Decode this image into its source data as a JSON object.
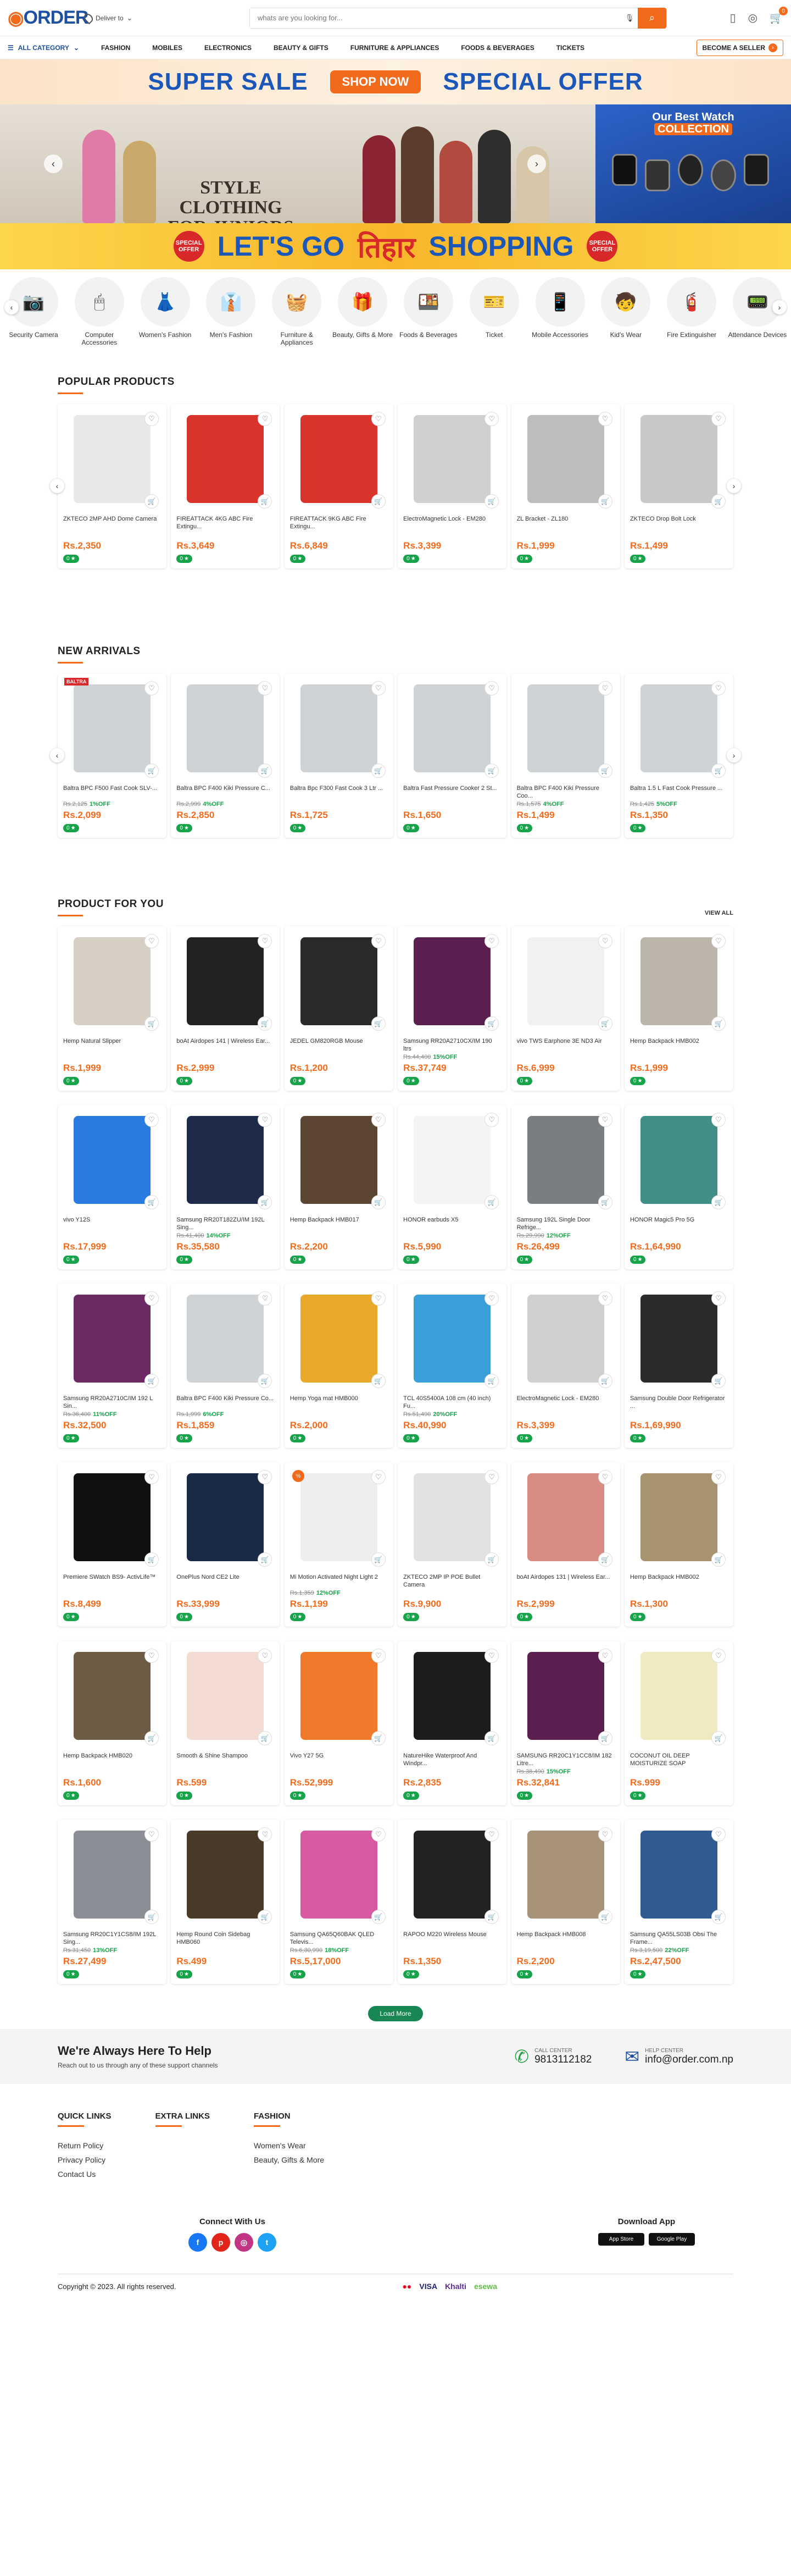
{
  "header": {
    "logo": "ORDER",
    "deliver": "Deliver to",
    "search_placeholder": "whats are you looking for...",
    "cart_count": "0"
  },
  "nav": {
    "all_category": "ALL CATEGORY",
    "items": [
      "FASHION",
      "MOBILES",
      "ELECTRONICS",
      "BEAUTY & GIFTS",
      "FURNITURE & APPLIANCES",
      "FOODS & BEVERAGES",
      "TICKETS"
    ],
    "seller": "BECOME A SELLER"
  },
  "banners": {
    "sale_left": "SUPER SALE",
    "sale_btn": "SHOP NOW",
    "sale_right": "SPECIAL OFFER",
    "hero_text": "STYLE CLOTHING FOR JUNIORS",
    "watch_title_1": "Our Best Watch",
    "watch_title_2": "COLLECTION",
    "tihar_left": "LET'S GO",
    "tihar_mid": "तिहार",
    "tihar_right": "SHOPPING",
    "tihar_tag": "SPECIAL OFFER"
  },
  "categories": [
    {
      "name": "Security Camera",
      "icon": "📷"
    },
    {
      "name": "Computer Accessories",
      "icon": "🖱"
    },
    {
      "name": "Women's Fashion",
      "icon": "👗"
    },
    {
      "name": "Men's Fashion",
      "icon": "👔"
    },
    {
      "name": "Furniture & Appliances",
      "icon": "🧺"
    },
    {
      "name": "Beauty, Gifts & More",
      "icon": "🎁"
    },
    {
      "name": "Foods & Beverages",
      "icon": "🍱"
    },
    {
      "name": "Ticket",
      "icon": "🎫"
    },
    {
      "name": "Mobile Accessories",
      "icon": "📱"
    },
    {
      "name": "Kid's Wear",
      "icon": "🧒"
    },
    {
      "name": "Fire Extinguisher",
      "icon": "🧯"
    },
    {
      "name": "Attendance Devices",
      "icon": "📟"
    }
  ],
  "popular": {
    "title": "POPULAR PRODUCTS",
    "items": [
      {
        "name": "ZKTECO 2MP AHD Dome Camera",
        "price": "Rs.2,350",
        "old": "",
        "off": "",
        "rating": "0",
        "color": "#e8e8e8"
      },
      {
        "name": "FIREATTACK 4KG ABC Fire Extingu...",
        "price": "Rs.3,649",
        "old": "",
        "off": "",
        "rating": "0",
        "color": "#d9342b"
      },
      {
        "name": "FIREATTACK 9KG ABC Fire Extingu...",
        "price": "Rs.6,849",
        "old": "",
        "off": "",
        "rating": "0",
        "color": "#d9342b"
      },
      {
        "name": "ElectroMagnetic Lock - EM280",
        "price": "Rs.3,399",
        "old": "",
        "off": "",
        "rating": "0",
        "color": "#cfcfcf"
      },
      {
        "name": "ZL Bracket - ZL180",
        "price": "Rs.1,999",
        "old": "",
        "off": "",
        "rating": "0",
        "color": "#bdbdbd"
      },
      {
        "name": "ZKTECO Drop Bolt Lock",
        "price": "Rs.1,499",
        "old": "",
        "off": "",
        "rating": "0",
        "color": "#c8c8c8"
      }
    ]
  },
  "arrivals": {
    "title": "NEW ARRIVALS",
    "items": [
      {
        "name": "Baltra BPC F500 Fast Cook SLV-...",
        "price": "Rs.2,099",
        "old": "Rs.2,125",
        "off": "1%OFF",
        "rating": "0",
        "color": "#cfd3d6",
        "badge": "BALTRA"
      },
      {
        "name": "Baltra BPC F400 Kiki Pressure C...",
        "price": "Rs.2,850",
        "old": "Rs.2,999",
        "off": "4%OFF",
        "rating": "0",
        "color": "#cfd3d6"
      },
      {
        "name": "Baltra Bpc F300 Fast Cook 3 Ltr ...",
        "price": "Rs.1,725",
        "old": "",
        "off": "",
        "rating": "0",
        "color": "#cfd3d6"
      },
      {
        "name": "Baltra Fast Pressure Cooker 2 St...",
        "price": "Rs.1,650",
        "old": "",
        "off": "",
        "rating": "0",
        "color": "#cfd3d6"
      },
      {
        "name": "Baltra BPC F400 Kiki Pressure Coo...",
        "price": "Rs.1,499",
        "old": "Rs.1,575",
        "off": "4%OFF",
        "rating": "0",
        "color": "#cfd3d6"
      },
      {
        "name": "Baltra 1.5 L Fast Cook Pressure ...",
        "price": "Rs.1,350",
        "old": "Rs.1,425",
        "off": "5%OFF",
        "rating": "0",
        "color": "#cfd3d6"
      }
    ]
  },
  "foryou": {
    "title": "PRODUCT FOR YOU",
    "view_all": "VIEW ALL",
    "items": [
      {
        "name": "Hemp Natural Slipper",
        "price": "Rs.1,999",
        "old": "",
        "off": "",
        "rating": "0",
        "color": "#d7cfc3"
      },
      {
        "name": "boAt Airdopes 141 | Wireless Ear...",
        "price": "Rs.2,999",
        "old": "",
        "off": "",
        "rating": "0",
        "color": "#222222"
      },
      {
        "name": "JEDEL GM820RGB Mouse",
        "price": "Rs.1,200",
        "old": "",
        "off": "",
        "rating": "0",
        "color": "#2a2a2a"
      },
      {
        "name": "Samsung RR20A2710CX/IM 190 ltrs",
        "price": "Rs.37,749",
        "old": "Rs.44,400",
        "off": "15%OFF",
        "rating": "0",
        "color": "#5b1f4f"
      },
      {
        "name": "vivo TWS Earphone 3E ND3 Air",
        "price": "Rs.6,999",
        "old": "",
        "off": "",
        "rating": "0",
        "color": "#f1f1f1"
      },
      {
        "name": "Hemp Backpack HMB002",
        "price": "Rs.1,999",
        "old": "",
        "off": "",
        "rating": "0",
        "color": "#bdb5aa"
      },
      {
        "name": "vivo Y12S",
        "price": "Rs.17,999",
        "old": "",
        "off": "",
        "rating": "0",
        "color": "#2a7be0"
      },
      {
        "name": "Samsung RR20T182ZU/IM 192L Sing...",
        "price": "Rs.35,580",
        "old": "Rs.41,400",
        "off": "14%OFF",
        "rating": "0",
        "color": "#1d2a4a"
      },
      {
        "name": "Hemp Backpack HMB017",
        "price": "Rs.2,200",
        "old": "",
        "off": "",
        "rating": "0",
        "color": "#5a4632"
      },
      {
        "name": "HONOR earbuds X5",
        "price": "Rs.5,990",
        "old": "",
        "off": "",
        "rating": "0",
        "color": "#f4f4f4"
      },
      {
        "name": "Samsung 192L Single Door Refrige...",
        "price": "Rs.26,499",
        "old": "Rs.29,990",
        "off": "12%OFF",
        "rating": "0",
        "color": "#7a7d82"
      },
      {
        "name": "HONOR Magic5 Pro 5G",
        "price": "Rs.1,64,990",
        "old": "",
        "off": "",
        "rating": "0",
        "color": "#3f8f86"
      },
      {
        "name": "Samsung RR20A2710C/IM 192 L Sin...",
        "price": "Rs.32,500",
        "old": "Rs.36,400",
        "off": "11%OFF",
        "rating": "0",
        "color": "#6b2a63"
      },
      {
        "name": "Baltra BPC F400 Kiki Pressure Co...",
        "price": "Rs.1,859",
        "old": "Rs.1,999",
        "off": "6%OFF",
        "rating": "0",
        "color": "#cfd3d6"
      },
      {
        "name": "Hemp Yoga mat HMB000",
        "price": "Rs.2,000",
        "old": "",
        "off": "",
        "rating": "0",
        "color": "#e9a92a"
      },
      {
        "name": "TCL 40S5400A 108 cm (40 inch) Fu...",
        "price": "Rs.40,990",
        "old": "Rs.51,490",
        "off": "20%OFF",
        "rating": "0",
        "color": "#3a9ed8"
      },
      {
        "name": "ElectroMagnetic Lock - EM280",
        "price": "Rs.3,399",
        "old": "",
        "off": "",
        "rating": "0",
        "color": "#cfcfcf"
      },
      {
        "name": "Samsung Double Door Refrigerator ...",
        "price": "Rs.1,69,990",
        "old": "",
        "off": "",
        "rating": "0",
        "color": "#2b2b2b"
      },
      {
        "name": "Premiere SWatch BS9- ActivLife™",
        "price": "Rs.8,499",
        "old": "",
        "off": "",
        "rating": "0",
        "color": "#111111"
      },
      {
        "name": "OnePlus Nord CE2 Lite",
        "price": "Rs.33,999",
        "old": "",
        "off": "",
        "rating": "0",
        "color": "#1b2a44"
      },
      {
        "name": "Mi Motion Activated Night Light 2",
        "price": "Rs.1,199",
        "old": "Rs.1,359",
        "off": "12%OFF",
        "rating": "0",
        "color": "#eeeeee",
        "sale": "%"
      },
      {
        "name": "ZKTECO 2MP IP POE Bullet Camera",
        "price": "Rs.9,900",
        "old": "",
        "off": "",
        "rating": "0",
        "color": "#e2e2e2"
      },
      {
        "name": "boAt Airdopes 131 | Wireless Ear...",
        "price": "Rs.2,999",
        "old": "",
        "off": "",
        "rating": "0",
        "color": "#d98c84"
      },
      {
        "name": "Hemp Backpack HMB002",
        "price": "Rs.1,300",
        "old": "",
        "off": "",
        "rating": "0",
        "color": "#a7946f"
      },
      {
        "name": "Hemp Backpack HMB020",
        "price": "Rs.1,600",
        "old": "",
        "off": "",
        "rating": "0",
        "color": "#6e5b45"
      },
      {
        "name": "Smooth & Shine Shampoo",
        "price": "Rs.599",
        "old": "",
        "off": "",
        "rating": "0",
        "color": "#f2dcd4"
      },
      {
        "name": "Vivo Y27 5G",
        "price": "Rs.52,999",
        "old": "",
        "off": "",
        "rating": "0",
        "color": "#f07a2a"
      },
      {
        "name": "NatureHike Waterproof And Windpr...",
        "price": "Rs.2,835",
        "old": "",
        "off": "",
        "rating": "0",
        "color": "#1c1c1c"
      },
      {
        "name": "SAMSUNG RR20C1Y1CC8/IM 182 Litre...",
        "price": "Rs.32,841",
        "old": "Rs.38,490",
        "off": "15%OFF",
        "rating": "0",
        "color": "#5b1f4f"
      },
      {
        "name": "COCONUT OIL DEEP MOISTURIZE SOAP",
        "price": "Rs.999",
        "old": "",
        "off": "",
        "rating": "0",
        "color": "#f0eac0"
      },
      {
        "name": "Samsung RR20C1Y1CS8/IM 192L Sing...",
        "price": "Rs.27,499",
        "old": "Rs.31,450",
        "off": "13%OFF",
        "rating": "0",
        "color": "#8b8e94"
      },
      {
        "name": "Hemp Round Coin Sidebag HMB060",
        "price": "Rs.499",
        "old": "",
        "off": "",
        "rating": "0",
        "color": "#4a3a2a"
      },
      {
        "name": "Samsung QA65Q60BAK QLED Televis...",
        "price": "Rs.5,17,000",
        "old": "Rs.6,30,990",
        "off": "18%OFF",
        "rating": "0",
        "color": "#d85aa0"
      },
      {
        "name": "RAPOO M220 Wireless Mouse",
        "price": "Rs.1,350",
        "old": "",
        "off": "",
        "rating": "0",
        "color": "#222222"
      },
      {
        "name": "Hemp Backpack HMB008",
        "price": "Rs.2,200",
        "old": "",
        "off": "",
        "rating": "0",
        "color": "#a6937a"
      },
      {
        "name": "Samsung QA55LS03B Obsi The Frame...",
        "price": "Rs.2,47,500",
        "old": "Rs.3,19,500",
        "off": "22%OFF",
        "rating": "0",
        "color": "#2f5a92"
      }
    ],
    "load_more": "Load More"
  },
  "help": {
    "title": "We're Always Here To Help",
    "sub": "Reach out to us through any of these support channels",
    "call_label": "CALL CENTER",
    "call_value": "9813112182",
    "mail_label": "HELP CENTER",
    "mail_value": "info@order.com.np"
  },
  "footer": {
    "cols": [
      {
        "title": "QUICK LINKS",
        "links": [
          "Return Policy",
          "Privacy Policy",
          "Contact Us"
        ]
      },
      {
        "title": "EXTRA LINKS",
        "links": []
      },
      {
        "title": "FASHION",
        "links": [
          "Women's Wear",
          "Beauty, Gifts & More"
        ]
      }
    ],
    "connect": "Connect With Us",
    "download": "Download App",
    "app_store": "App Store",
    "google_play": "Google Play",
    "copyright": "Copyright © 2023. All rights reserved.",
    "payments": [
      "mastercard",
      "VISA",
      "Khalti",
      "esewa"
    ]
  }
}
